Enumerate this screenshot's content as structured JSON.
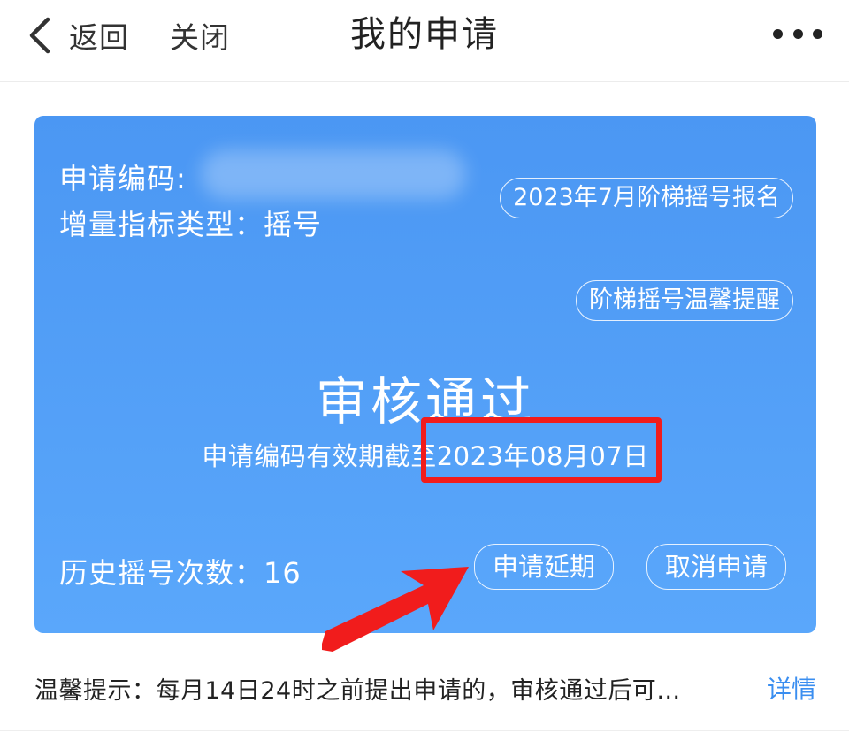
{
  "nav": {
    "back_label": "返回",
    "close_label": "关闭",
    "title": "我的申请",
    "more_icon": "more-dots-icon"
  },
  "card": {
    "code_label": "申请编码:",
    "quota_type": "增量指标类型：摇号",
    "signup_button": "2023年7月阶梯摇号报名",
    "reminder_button": "阶梯摇号温馨提醒",
    "status": "审核通过",
    "validity": "申请编码有效期截至2023年08月07日",
    "history": "历史摇号次数：16",
    "extend_button": "申请延期",
    "cancel_button": "取消申请"
  },
  "tip": {
    "text": "温馨提示：每月14日24时之前提出申请的，审核通过后可…",
    "link": "详情"
  },
  "colors": {
    "card_top": "#4b97f3",
    "card_bottom": "#5aa7fb",
    "annotation_red": "#f11c1c",
    "link_blue": "#3a8ef0"
  }
}
